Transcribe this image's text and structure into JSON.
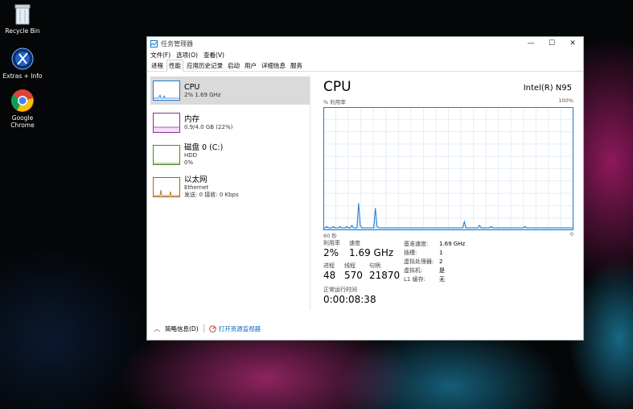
{
  "desktop": {
    "icons": [
      {
        "label": "Recycle Bin"
      },
      {
        "label": "Extras + Info"
      },
      {
        "label": "Google Chrome"
      }
    ]
  },
  "window": {
    "title": "任务管理器",
    "menu": [
      "文件(F)",
      "选项(O)",
      "查看(V)"
    ],
    "tabs": [
      "进程",
      "性能",
      "应用历史记录",
      "启动",
      "用户",
      "详细信息",
      "服务"
    ],
    "active_tab": "性能"
  },
  "sidebar": {
    "items": [
      {
        "name": "CPU",
        "sub1": "2% 1.69 GHz",
        "sub2": "",
        "color": "#1a7ad1"
      },
      {
        "name": "内存",
        "sub1": "0.9/4.0 GB (22%)",
        "sub2": "",
        "color": "#8b2b9c"
      },
      {
        "name": "磁盘 0 (C:)",
        "sub1": "HDD",
        "sub2": "0%",
        "color": "#4a8a1f"
      },
      {
        "name": "以太网",
        "sub1": "Ethernet",
        "sub2": "发送: 0 接收: 0 Kbps",
        "color": "#a8630f"
      }
    ]
  },
  "cpu": {
    "title": "CPU",
    "model": "Intel(R) N95",
    "graph_label_left": "% 利用率",
    "graph_label_right": "100%",
    "graph_bottom_left": "60 秒",
    "graph_bottom_right": "0",
    "usage_series": [
      2,
      2,
      3,
      2,
      2,
      2,
      3,
      2,
      2,
      2,
      3,
      2,
      2,
      2,
      3,
      2,
      2,
      4,
      2,
      2,
      2,
      22,
      4,
      2,
      2,
      2,
      2,
      2,
      2,
      2,
      2,
      18,
      3,
      2,
      2,
      2,
      2,
      2,
      2,
      2,
      2,
      2,
      2,
      2,
      2,
      2,
      2,
      2,
      2,
      2,
      2,
      2,
      2,
      2,
      2,
      2,
      2,
      2,
      2,
      2,
      2,
      2,
      2,
      2,
      2,
      2,
      2,
      2,
      2,
      2,
      2,
      2,
      2,
      2,
      2,
      2,
      2,
      2,
      2,
      2,
      2,
      2,
      2,
      2,
      7,
      2,
      2,
      2,
      2,
      2,
      2,
      2,
      2,
      4,
      2,
      2,
      2,
      2,
      2,
      2,
      3,
      2,
      2,
      2,
      2,
      2,
      2,
      2,
      2,
      2,
      2,
      2,
      2,
      2,
      2,
      2,
      2,
      2,
      2,
      2,
      3,
      2,
      2,
      2,
      2,
      2,
      2,
      2,
      2,
      2,
      2,
      2,
      2,
      2,
      2,
      2,
      2,
      2,
      2,
      2,
      2,
      2,
      2,
      2,
      2,
      2,
      2,
      2,
      2,
      2
    ],
    "stats": {
      "util_label": "利用率",
      "util_value": "2%",
      "speed_label": "速度",
      "speed_value": "1.69 GHz",
      "proc_label": "进程",
      "proc_value": "48",
      "thread_label": "线程",
      "thread_value": "570",
      "handle_label": "句柄",
      "handle_value": "21870",
      "uptime_label": "正常运行时间",
      "uptime_value": "0:00:08:38"
    },
    "specs": [
      {
        "k": "基准速度:",
        "v": "1.69 GHz"
      },
      {
        "k": "插槽:",
        "v": "1"
      },
      {
        "k": "虚拟处理器:",
        "v": "2"
      },
      {
        "k": "虚拟机:",
        "v": "是"
      },
      {
        "k": "L1 缓存:",
        "v": "无"
      }
    ]
  },
  "footer": {
    "brief": "简略信息(D)",
    "monitor": "打开资源监视器"
  },
  "colors": {
    "cpu_line": "#1a7ad1",
    "grid": "#e6eef5"
  }
}
